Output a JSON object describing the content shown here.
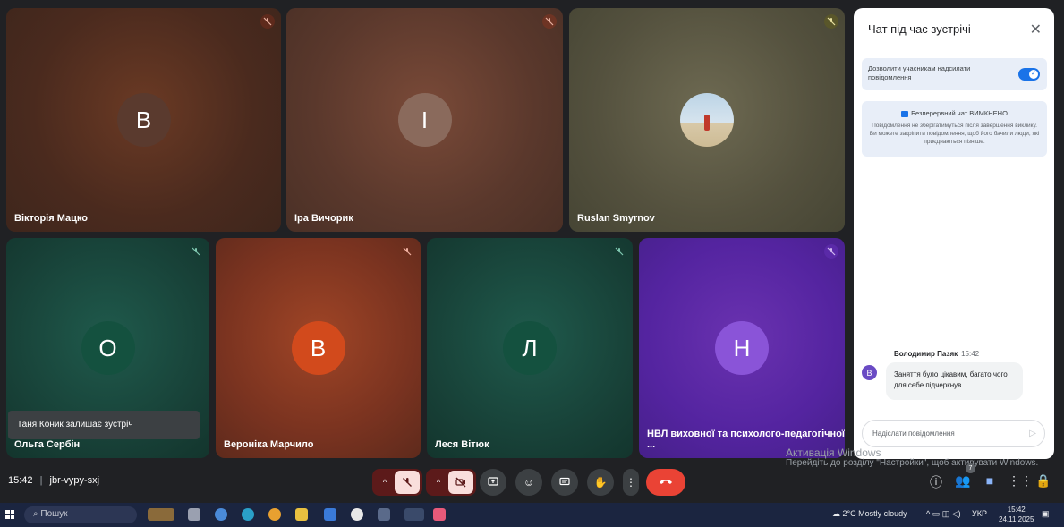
{
  "participants": [
    {
      "name": "Вікторія Мацко",
      "initial": "В",
      "avatar_color": "#5a3a2e",
      "mute_color": "#5e2a1c"
    },
    {
      "name": "Іра Вичорик",
      "initial": "І",
      "avatar_color": "#8a6a5c",
      "mute_color": "#6e3424"
    },
    {
      "name": "Ruslan Smyrnov",
      "initial": "",
      "avatar_color": "#cfe0ea",
      "mute_color": "#59562a"
    },
    {
      "name": "Ольга Сербін",
      "initial": "О",
      "avatar_color": "#14513f",
      "mute_color": "#173f36"
    },
    {
      "name": "Вероніка Марчило",
      "initial": "В",
      "avatar_color": "#d24a1c",
      "mute_color": "#6e2a1c"
    },
    {
      "name": "Леся Вітюк",
      "initial": "Л",
      "avatar_color": "#14513f",
      "mute_color": "#173f36"
    },
    {
      "name": "НВЛ виховної та психолого-педагогічної ...",
      "initial": "Н",
      "avatar_color": "#8a54d8",
      "mute_color": "#5a2aa8"
    }
  ],
  "toast": "Таня Коник залишає зустріч",
  "chat": {
    "title": "Чат під час зустрічі",
    "allow_messages": "Дозволити учасникам надсилати повідомлення",
    "continuous_chat_heading": "Безперервний чат ВИМКНЕНО",
    "continuous_chat_body": "Повідомлення не зберігатимуться після завершення виклику. Ви можете закріпити повідомлення, щоб його бачили люди, які приєднаються пізніше.",
    "message": {
      "author": "Володимир Пазяк",
      "time": "15:42",
      "initial": "В",
      "text": "Заняття було цікавим, багато чого для себе підчеркнув."
    },
    "input_placeholder": "Надіслати повідомлення"
  },
  "meeting": {
    "time": "15:42",
    "separator": "|",
    "code": "jbr-vypy-sxj",
    "participant_count": "7"
  },
  "controls": {
    "mic_off_color": "#f9dedc",
    "cam_off_color": "#f9dedc",
    "end_call_color": "#ea4335",
    "button_color": "#3c4043"
  },
  "watermark": {
    "title": "Активація Windows",
    "text": "Перейдіть до розділу \"Настройки\", щоб активувати Windows."
  },
  "taskbar": {
    "search": "Пошук",
    "weather": "2°C Mostly cloudy",
    "lang": "УКР",
    "time": "15:42",
    "date": "24.11.2025"
  },
  "icons": {
    "mic_off": "mic-off-icon",
    "cam_off": "camera-off-icon",
    "present": "present-icon",
    "emoji": "emoji-icon",
    "captions": "captions-icon",
    "hand": "raise-hand-icon",
    "more": "more-options-icon",
    "end": "end-call-icon"
  }
}
